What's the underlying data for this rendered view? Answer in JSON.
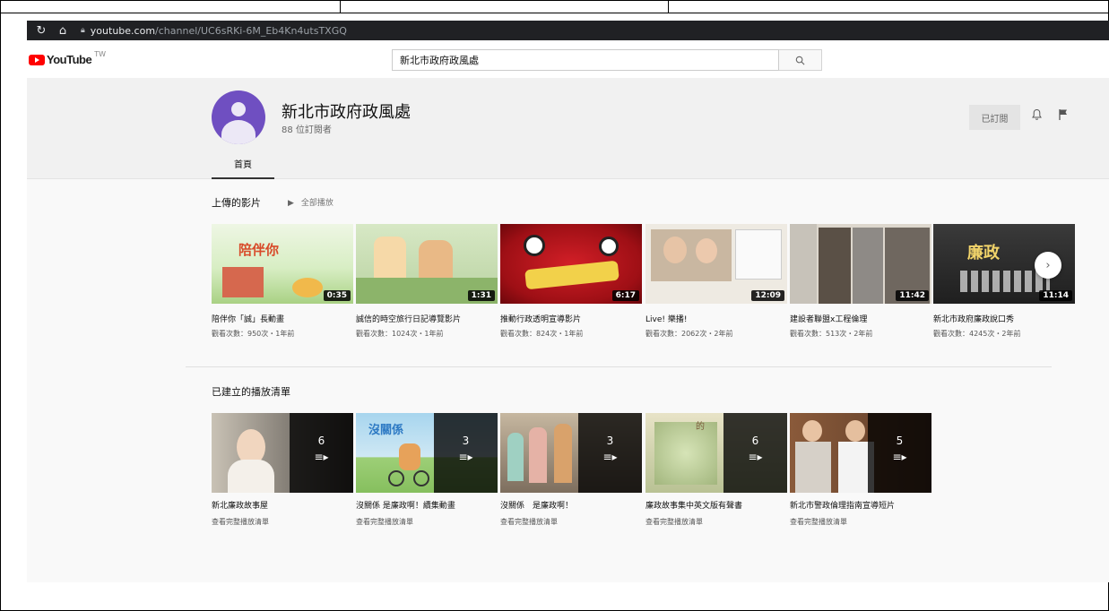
{
  "browser": {
    "url_host": "youtube.com",
    "url_path": "/channel/UC6sRKi-6M_Eb4Kn4utsTXGQ"
  },
  "header": {
    "logo_text": "YouTube",
    "region": "TW",
    "search_value": "新北市政府政風處"
  },
  "channel": {
    "name": "新北市政府政風處",
    "subscribers": "88 位訂閱者",
    "subscribed_label": "已訂閱",
    "tab_home": "首頁"
  },
  "uploads": {
    "title": "上傳的影片",
    "play_all": "全部播放",
    "videos": [
      {
        "title": "陪伴你「誠」長動畫",
        "meta": "觀看次數：950次・1年前",
        "duration": "0:35",
        "color": "#9fc97e"
      },
      {
        "title": "誠信的時空旅行日記導覽影片",
        "meta": "觀看次數：1024次・1年前",
        "duration": "1:31",
        "color": "#cfe3b5"
      },
      {
        "title": "推動行政透明宣導影片",
        "meta": "觀看次數：824次・1年前",
        "duration": "6:17",
        "color": "#b3151c"
      },
      {
        "title": "Live! 樂播!",
        "meta": "觀看次數：2062次・2年前",
        "duration": "12:09",
        "color": "#e9e3d8"
      },
      {
        "title": "建設者聯盟x工程倫理",
        "meta": "觀看次數：513次・2年前",
        "duration": "11:42",
        "color": "#7d7266"
      },
      {
        "title": "新北市政府廉政說口秀",
        "meta": "觀看次數：4245次・2年前",
        "duration": "11:14",
        "color": "#2b2b2b"
      }
    ]
  },
  "playlists": {
    "title": "已建立的播放清單",
    "items": [
      {
        "title": "新北廉政故事屋",
        "link": "查看完整播放清單",
        "count": "6",
        "color": "#3a3532"
      },
      {
        "title": "沒關係 是廉政啊！續集動畫",
        "link": "查看完整播放清單",
        "count": "3",
        "color": "#8fc3e0"
      },
      {
        "title": "沒關係　是廉政啊！",
        "link": "查看完整播放清單",
        "count": "3",
        "color": "#8a7d6e"
      },
      {
        "title": "廉政故事集中英文版有聲書",
        "link": "查看完整播放清單",
        "count": "6",
        "color": "#b8b08a"
      },
      {
        "title": "新北市警政倫理指南宣導短片",
        "link": "查看完整播放清單",
        "count": "5",
        "color": "#6b4a35"
      }
    ]
  },
  "icons": {
    "reload": "reload-icon",
    "home": "home-icon",
    "lock": "lock-icon",
    "search": "search-icon",
    "bell": "bell-icon",
    "flag": "flag-icon",
    "next": "chevron-right-icon",
    "playlist": "playlist-icon",
    "play": "play-icon"
  }
}
